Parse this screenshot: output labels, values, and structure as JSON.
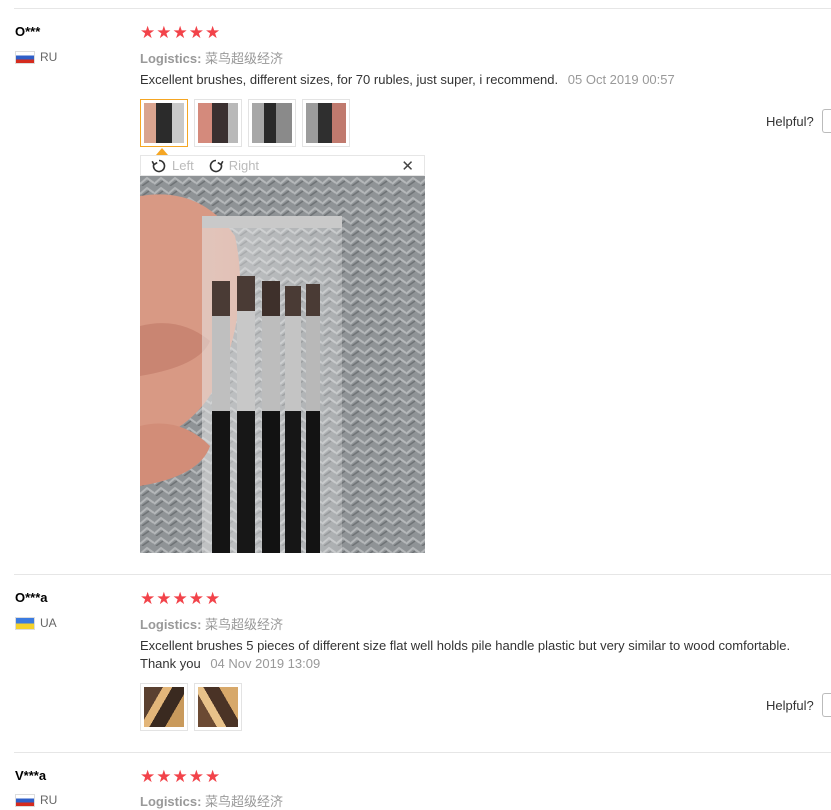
{
  "reviews": [
    {
      "user": "O***",
      "country": "RU",
      "stars": "★★★★★",
      "logistics_label": "Logistics:",
      "logistics_value": "菜鸟超级经济",
      "text": "Excellent brushes, different sizes, for 70 rubles, just super, i recommend.",
      "date": "05 Oct 2019 00:57",
      "helpful": "Helpful?"
    },
    {
      "user": "O***a",
      "country": "UA",
      "stars": "★★★★★",
      "logistics_label": "Logistics:",
      "logistics_value": "菜鸟超级经济",
      "text_line1": "Excellent brushes 5 pieces of different size flat well holds pile handle plastic but very similar to wood comfortable.",
      "text_line2": "Thank you",
      "date": "04 Nov 2019 13:09",
      "helpful": "Helpful?"
    },
    {
      "user": "V***a",
      "country": "RU",
      "stars": "★★★★★",
      "logistics_label": "Logistics:",
      "logistics_value": "菜鸟超级经济"
    }
  ],
  "viewer": {
    "rotate_left": "Left",
    "rotate_right": "Right",
    "close": "✕"
  },
  "colors": {
    "star": "#f2434a",
    "selected_thumb": "#f5a623",
    "muted": "#999999"
  }
}
